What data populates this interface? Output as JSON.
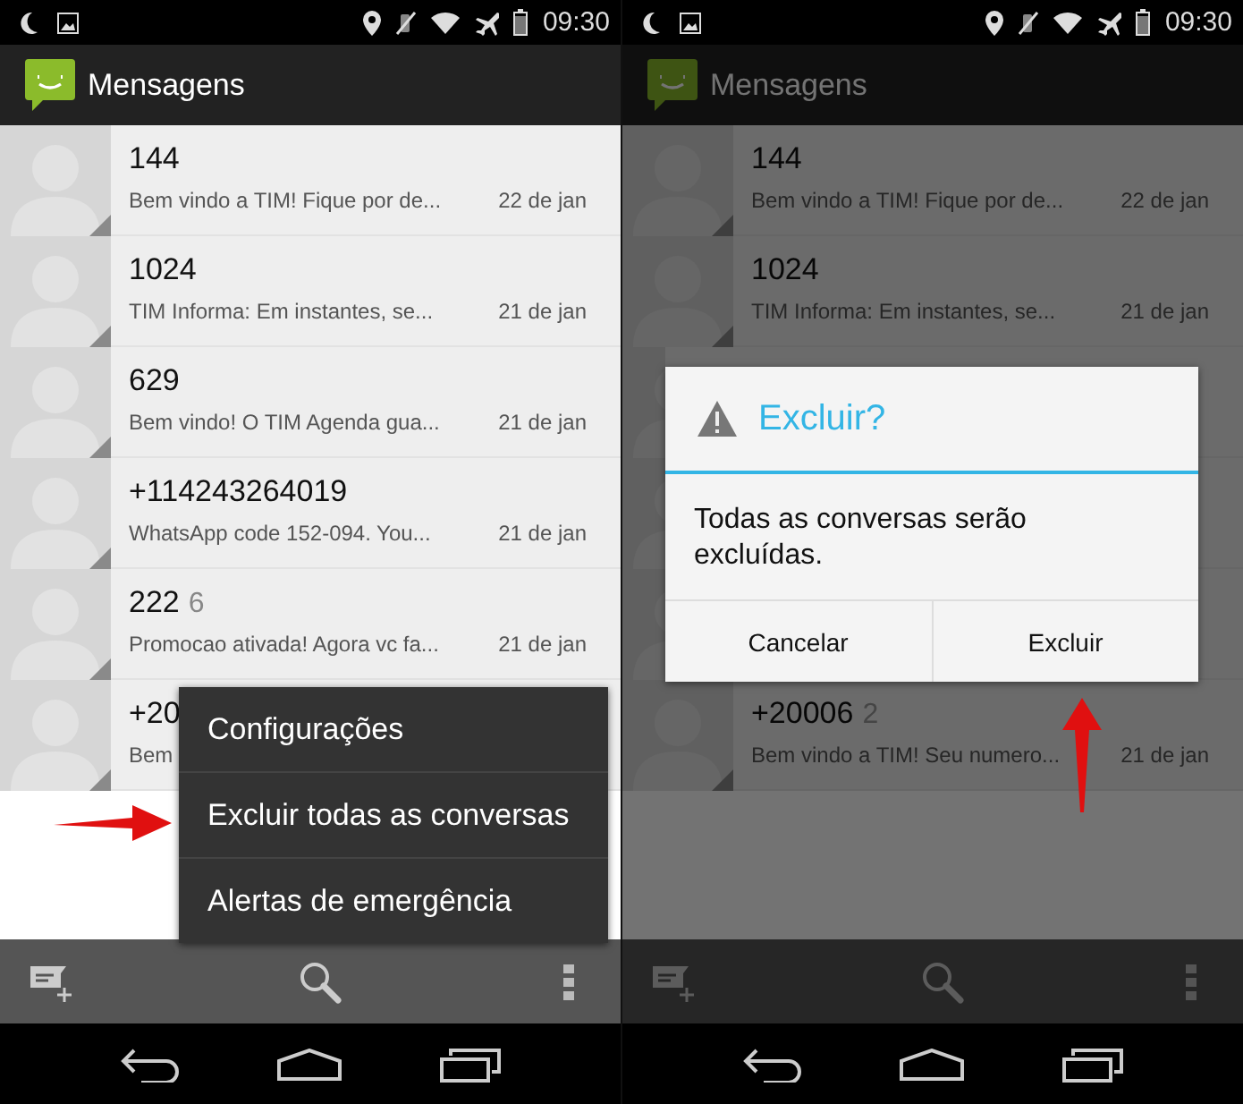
{
  "screens": [
    {
      "status_bar": {
        "time": "09:30"
      },
      "app_bar": {
        "title": "Mensagens"
      },
      "dimmed": false,
      "conversations": [
        {
          "kind": "full",
          "name": "144",
          "snippet": "Bem vindo a TIM! Fique por de...",
          "date": "22 de jan"
        },
        {
          "kind": "full",
          "name": "1024",
          "snippet": "TIM Informa: Em instantes, se...",
          "date": "21 de jan"
        },
        {
          "kind": "full",
          "name": "629",
          "snippet": "Bem vindo! O TIM Agenda gua...",
          "date": "21 de jan"
        },
        {
          "kind": "full",
          "name": "+114243264019",
          "snippet": "WhatsApp code 152-094.  You...",
          "date": "21 de jan"
        },
        {
          "kind": "full",
          "name": "222",
          "count": "6",
          "snippet": "Promocao ativada! Agora vc fa...",
          "date": "21 de jan"
        },
        {
          "kind": "full",
          "name": "+20",
          "snippet": "Bem"
        }
      ],
      "overlay": {
        "kind": "menu",
        "items": [
          "Configurações",
          "Excluir todas as conversas",
          "Alertas de emergência"
        ]
      },
      "pointer": {
        "kind": "right-arrow"
      }
    },
    {
      "status_bar": {
        "time": "09:30"
      },
      "app_bar": {
        "title": "Mensagens"
      },
      "dimmed": true,
      "conversations": [
        {
          "kind": "full",
          "name": "144",
          "snippet": "Bem vindo a TIM! Fique por de...",
          "date": "22 de jan"
        },
        {
          "kind": "full",
          "name": "1024",
          "snippet": "TIM Informa: Em instantes, se...",
          "date": "21 de jan"
        },
        {
          "kind": "covered"
        },
        {
          "kind": "covered"
        },
        {
          "kind": "covered"
        },
        {
          "kind": "full",
          "name": "+20006",
          "count": "2",
          "snippet": "Bem vindo a TIM! Seu numero...",
          "date": "21 de jan"
        }
      ],
      "overlay": {
        "kind": "dialog",
        "title": "Excluir?",
        "message": "Todas as conversas serão excluídas.",
        "buttons": [
          "Cancelar",
          "Excluir"
        ]
      },
      "pointer": {
        "kind": "up-arrow"
      }
    }
  ]
}
